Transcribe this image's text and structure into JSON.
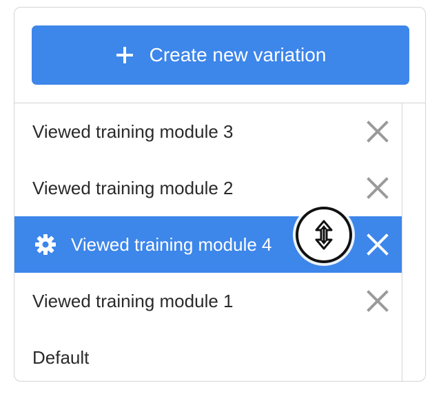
{
  "create_button": {
    "label": "Create new variation",
    "icon": "plus-icon"
  },
  "variations": [
    {
      "label": "Viewed training module 3",
      "selected": false,
      "removable": true
    },
    {
      "label": "Viewed training module 2",
      "selected": false,
      "removable": true
    },
    {
      "label": "Viewed training module 4",
      "selected": true,
      "removable": true,
      "icon": "gear-icon"
    },
    {
      "label": "Viewed training module 1",
      "selected": false,
      "removable": true
    },
    {
      "label": "Default",
      "selected": false,
      "removable": false
    }
  ],
  "colors": {
    "accent": "#3d86ea",
    "text": "#2a2a2a",
    "close_icon": "#9a9a9a",
    "border": "#d4d4d4"
  },
  "cursor": {
    "icon": "resize-vertical-cursor-icon"
  }
}
